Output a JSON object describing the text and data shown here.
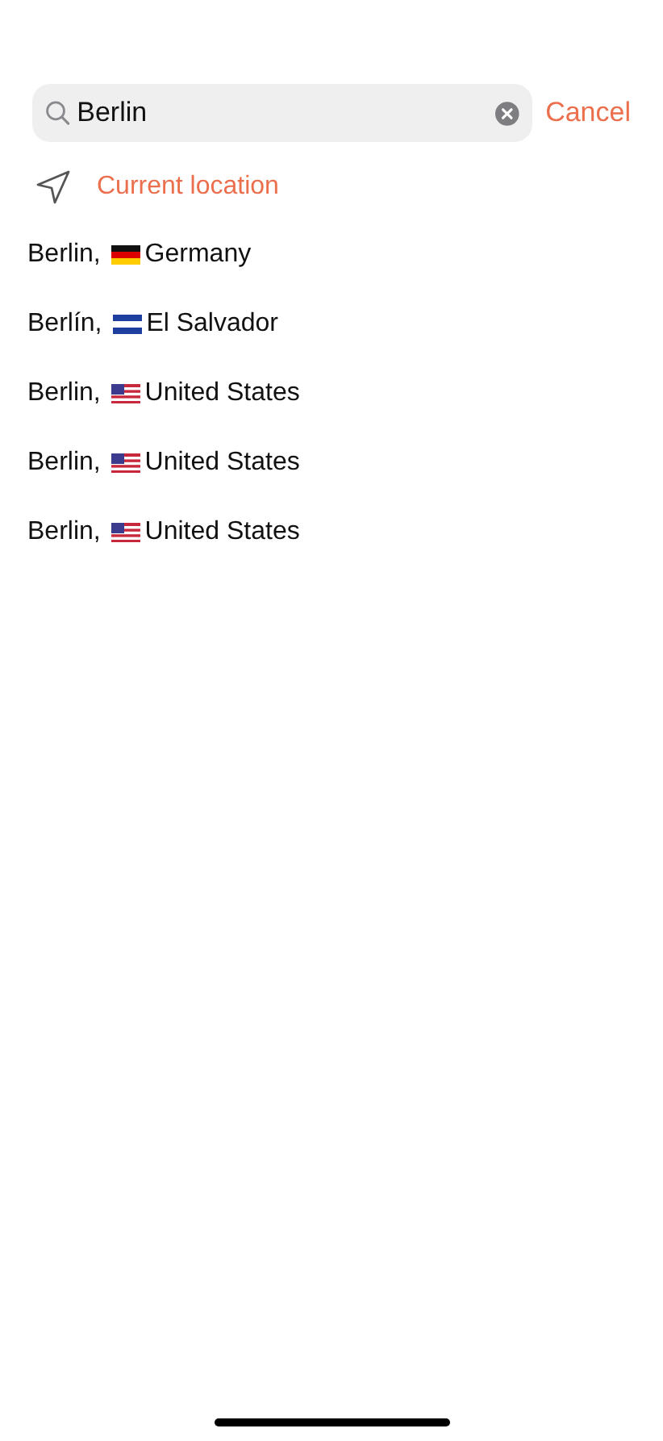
{
  "search": {
    "value": "Berlin",
    "cancel": "Cancel"
  },
  "current_location": {
    "label": "Current location"
  },
  "results": [
    {
      "city": "Berlin,",
      "country": "Germany",
      "kind": "de"
    },
    {
      "city": "Berlín,",
      "country": "El Salvador",
      "kind": "sv"
    },
    {
      "city": "Berlin,",
      "country": "United States",
      "kind": "us"
    },
    {
      "city": "Berlin,",
      "country": "United States",
      "kind": "us"
    },
    {
      "city": "Berlin,",
      "country": "United States",
      "kind": "us"
    }
  ]
}
